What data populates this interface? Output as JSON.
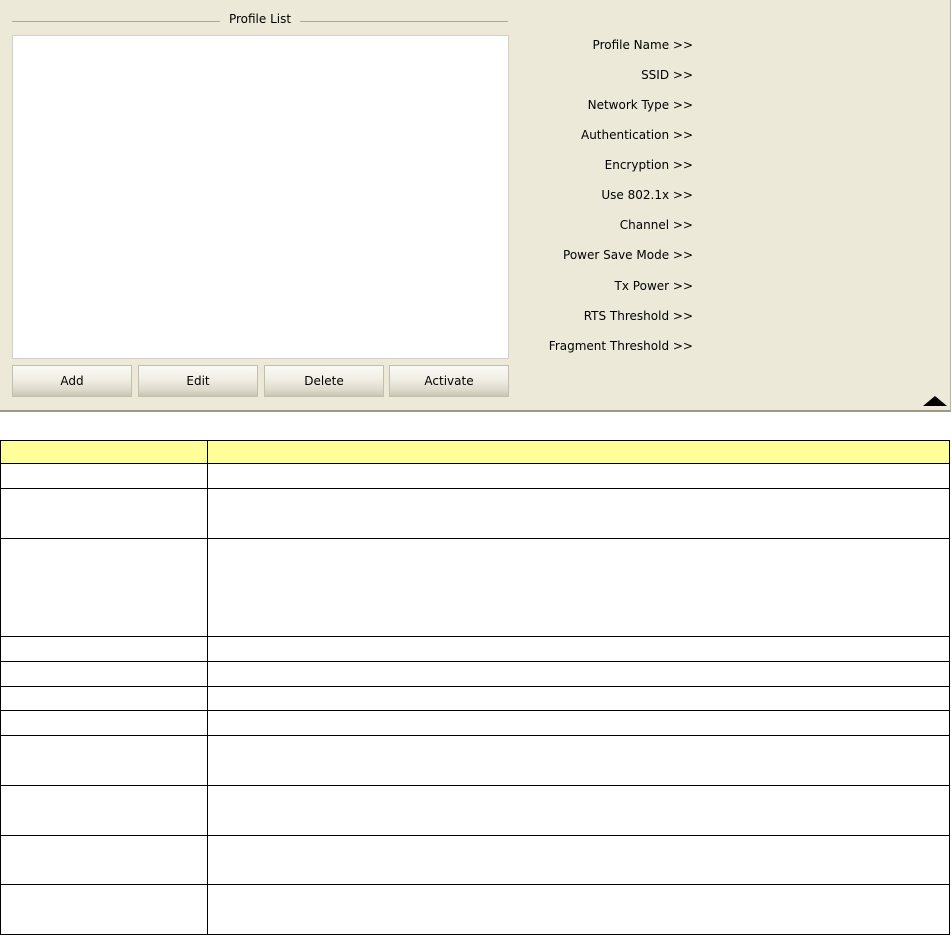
{
  "profile_group": {
    "title": "Profile List",
    "items": []
  },
  "buttons": {
    "add": "Add",
    "edit": "Edit",
    "delete": "Delete",
    "activate": "Activate"
  },
  "profile_info": {
    "labels": [
      "Profile Name >>",
      "SSID >>",
      "Network Type >>",
      "Authentication >>",
      "Encryption >>",
      "Use 802.1x >>",
      "Channel >>",
      "Power Save Mode >>",
      "Tx Power >>",
      "RTS Threshold >>",
      "Fragment Threshold >>"
    ]
  },
  "icons": {
    "collapse": "collapse-up-icon"
  },
  "colors": {
    "panel_bg": "#ece9d8",
    "table_header_bg": "#ffff99"
  },
  "table": {
    "header": [
      "",
      ""
    ],
    "rows": [
      [
        "",
        ""
      ],
      [
        "",
        ""
      ],
      [
        "",
        ""
      ],
      [
        "",
        ""
      ],
      [
        "",
        ""
      ],
      [
        "",
        ""
      ],
      [
        "",
        ""
      ],
      [
        "",
        ""
      ],
      [
        "",
        ""
      ],
      [
        "",
        ""
      ],
      [
        "",
        ""
      ]
    ]
  }
}
